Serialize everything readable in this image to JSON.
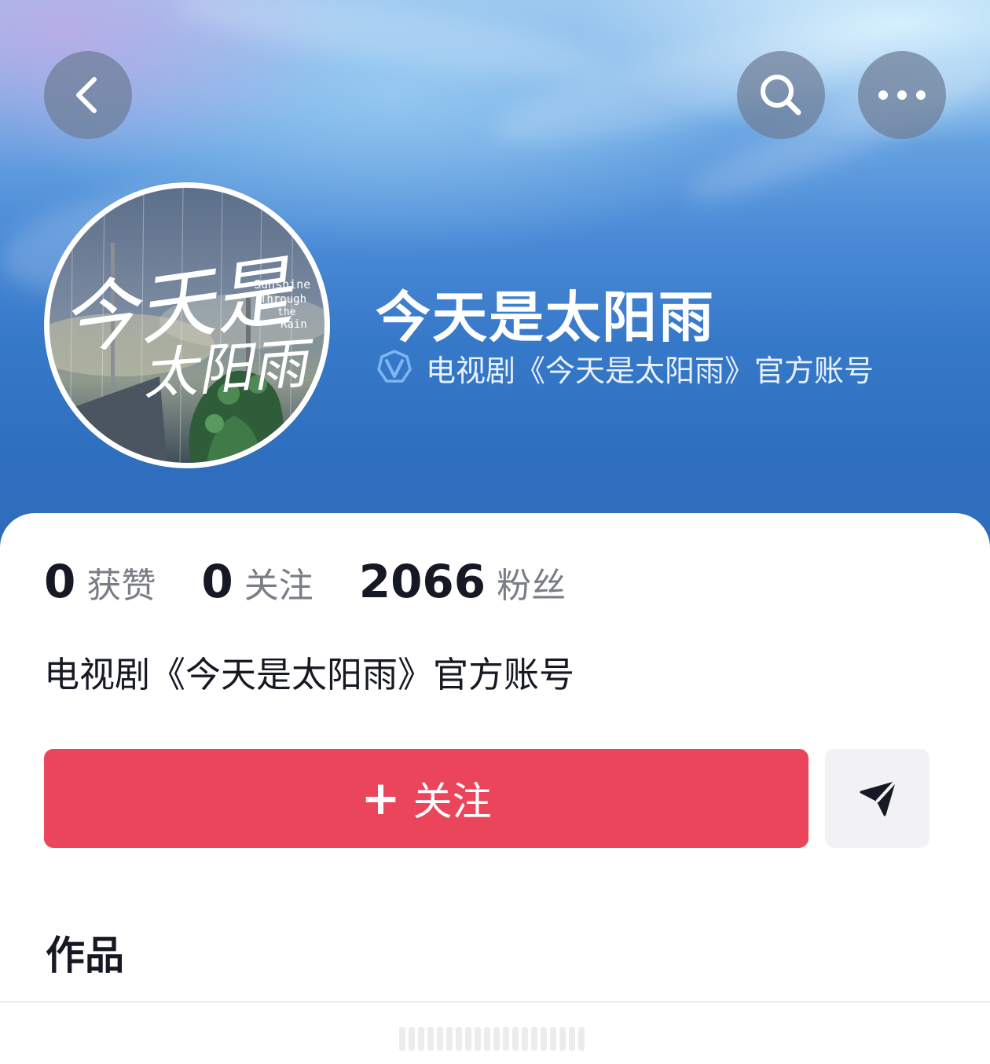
{
  "account": {
    "name": "今天是太阳雨",
    "verification_text": "电视剧《今天是太阳雨》官方账号",
    "bio": "电视剧《今天是太阳雨》官方账号"
  },
  "avatar": {
    "title_cn_line1": "今天是",
    "title_cn_line2": "太阳雨",
    "title_en": [
      "Sunshine",
      "Through",
      "the",
      "Rain"
    ]
  },
  "stats": [
    {
      "value": "0",
      "label": "获赞"
    },
    {
      "value": "0",
      "label": "关注"
    },
    {
      "value": "2066",
      "label": "粉丝"
    }
  ],
  "actions": {
    "follow_label": "关注",
    "follow_plus": "+"
  },
  "sections": {
    "works_title": "作品"
  },
  "icons": {
    "back": "back-icon",
    "search": "search-icon",
    "more": "more-icon",
    "verified": "verified-badge-icon",
    "share": "send-icon"
  },
  "colors": {
    "follow_button": "#ea455b",
    "verified_badge": "#7fb6f2",
    "header_blue": "#2f6fbf"
  }
}
